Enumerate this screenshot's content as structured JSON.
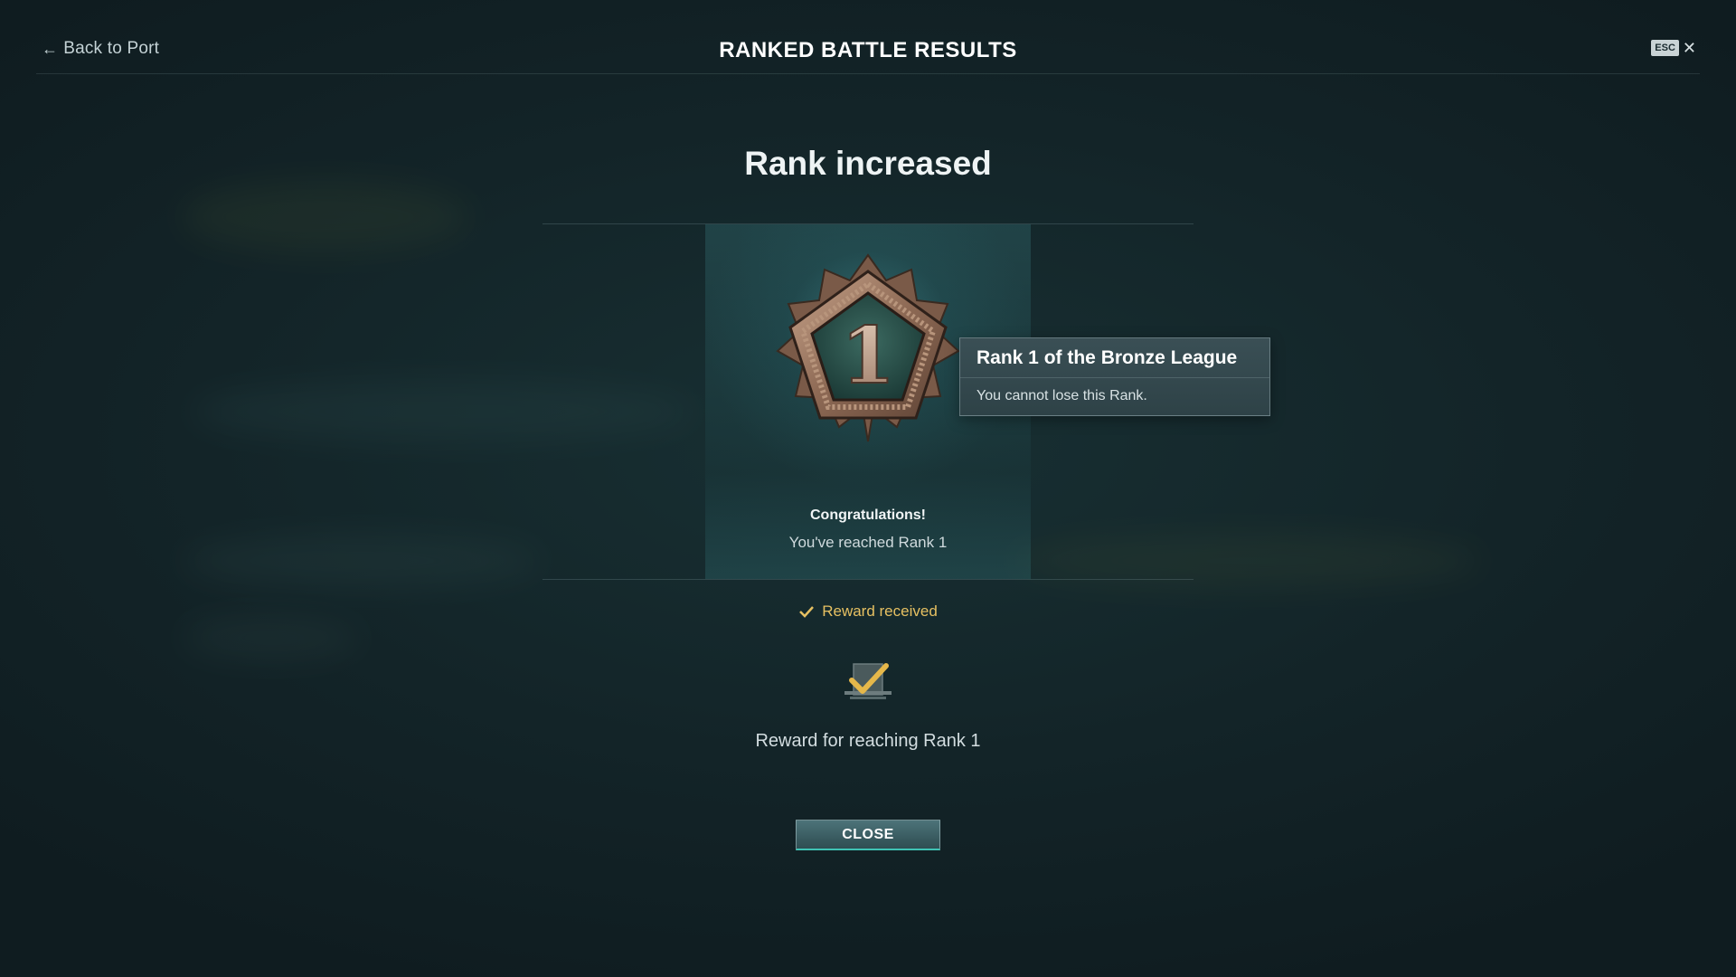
{
  "header": {
    "back_label": "Back to Port",
    "title": "RANKED BATTLE RESULTS",
    "esc_label": "ESC",
    "close_symbol": "✕"
  },
  "main": {
    "heading": "Rank increased",
    "emblem": {
      "rank_number": "1",
      "icon": "bronze-league-rank-emblem"
    },
    "tooltip": {
      "title": "Rank 1 of the Bronze League",
      "body": "You cannot lose this Rank."
    },
    "congrats": "Congratulations!",
    "reached": "You've reached Rank 1",
    "reward_status": "Reward received",
    "reward_caption": "Reward for reaching Rank 1",
    "close_button": "CLOSE"
  },
  "colors": {
    "accent_gold": "#e6c062",
    "button_underline": "#3fc3b4",
    "background": "#132428"
  }
}
